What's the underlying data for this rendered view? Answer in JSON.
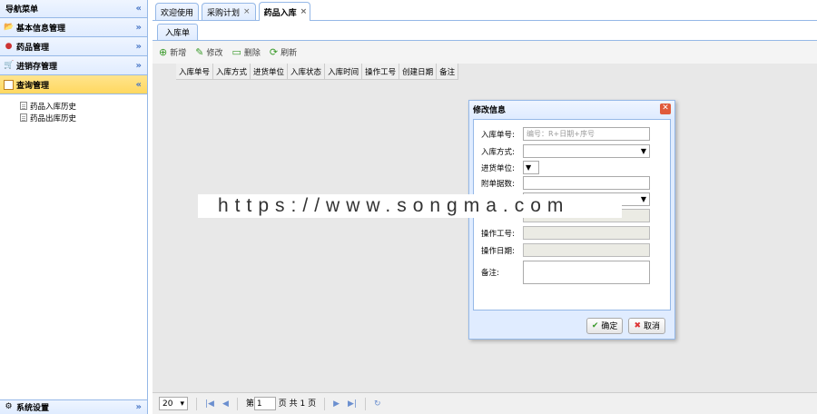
{
  "sidebar": {
    "header": "导航菜单",
    "sections": [
      {
        "label": "基本信息管理",
        "icon": "folder-icon"
      },
      {
        "label": "药品管理",
        "icon": "pill-icon"
      },
      {
        "label": "进销存管理",
        "icon": "cart-icon"
      },
      {
        "label": "查询管理",
        "icon": "query-icon",
        "active": true
      }
    ],
    "tree_items": [
      "药品入库历史",
      "药品出库历史"
    ],
    "bottom": "系统设置"
  },
  "tabs": [
    {
      "label": "欢迎使用",
      "closable": false
    },
    {
      "label": "采购计划",
      "closable": true
    },
    {
      "label": "药品入库",
      "closable": true,
      "selected": true
    }
  ],
  "subtab": "入库单",
  "toolbar": {
    "add": "新增",
    "edit": "修改",
    "delete": "删除",
    "refresh": "刷新"
  },
  "grid_columns": [
    "入库单号",
    "入库方式",
    "进货单位",
    "入库状态",
    "入库时间",
    "操作工号",
    "创建日期",
    "备注"
  ],
  "pager": {
    "page_size": "20",
    "page_prefix": "第",
    "page_value": "1",
    "page_suffix": "页 共 1 页"
  },
  "dialog": {
    "title": "修改信息",
    "fields": {
      "order_no_label": "入库单号:",
      "order_no_placeholder": "编号：R+日期+序号",
      "method_label": "入库方式:",
      "supplier_label": "进货单位:",
      "attach_label": "附单据数:",
      "operator_label": "操作工号:",
      "date_label": "操作日期:",
      "remark_label": "备注:"
    },
    "ok": "确定",
    "cancel": "取消"
  },
  "watermark": "https://www.songma.com"
}
